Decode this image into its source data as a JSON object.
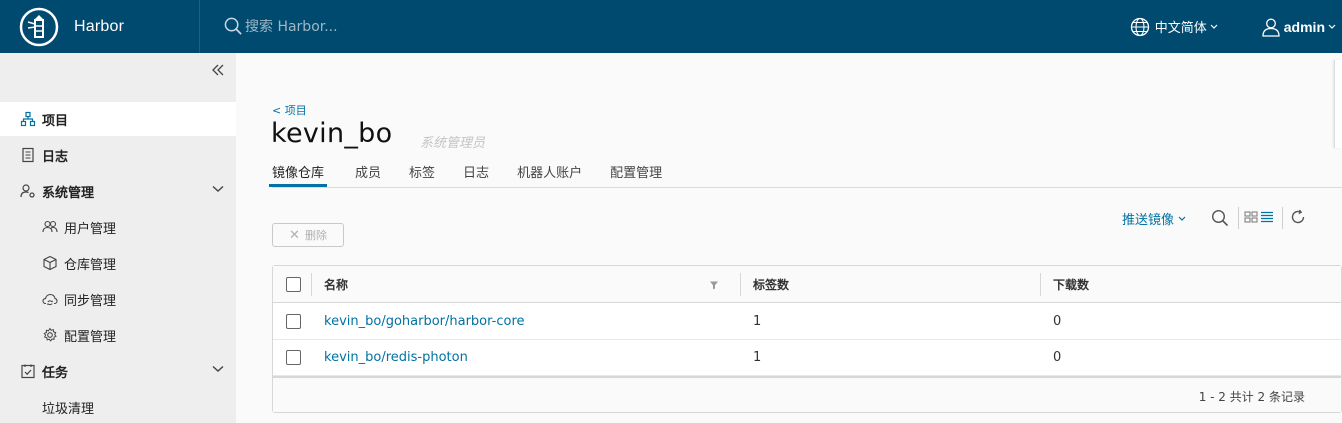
{
  "header": {
    "brand": "Harbor",
    "search_placeholder": "搜索 Harbor...",
    "language": "中文简体",
    "user": "admin"
  },
  "sidebar": {
    "items": [
      {
        "label": "项目",
        "icon": "project-icon"
      },
      {
        "label": "日志",
        "icon": "log-icon"
      },
      {
        "label": "系统管理",
        "icon": "system-admin-icon"
      },
      {
        "label": "用户管理",
        "icon": "users-icon"
      },
      {
        "label": "仓库管理",
        "icon": "cube-icon"
      },
      {
        "label": "同步管理",
        "icon": "cloud-sync-icon"
      },
      {
        "label": "配置管理",
        "icon": "gear-icon"
      },
      {
        "label": "任务",
        "icon": "task-icon"
      },
      {
        "label": "垃圾清理",
        "icon": ""
      }
    ]
  },
  "main": {
    "back_label": "< 项目",
    "title": "kevin_bo",
    "role": "系统管理员",
    "tabs": [
      "镜像仓库",
      "成员",
      "标签",
      "日志",
      "机器人账户",
      "配置管理"
    ],
    "active_tab": "镜像仓库",
    "toolbar": {
      "push_label": "推送镜像",
      "delete_label": "删除"
    },
    "table": {
      "columns": [
        "名称",
        "标签数",
        "下载数"
      ],
      "rows": [
        {
          "name": "kevin_bo/goharbor/harbor-core",
          "tags": "1",
          "pulls": "0"
        },
        {
          "name": "kevin_bo/redis-photon",
          "tags": "1",
          "pulls": "0"
        }
      ],
      "footer": "1 - 2 共计 2 条记录"
    }
  },
  "colors": {
    "header_bg": "#004a70",
    "accent": "#0072a3",
    "sidebar_bg": "#eeeeee"
  }
}
